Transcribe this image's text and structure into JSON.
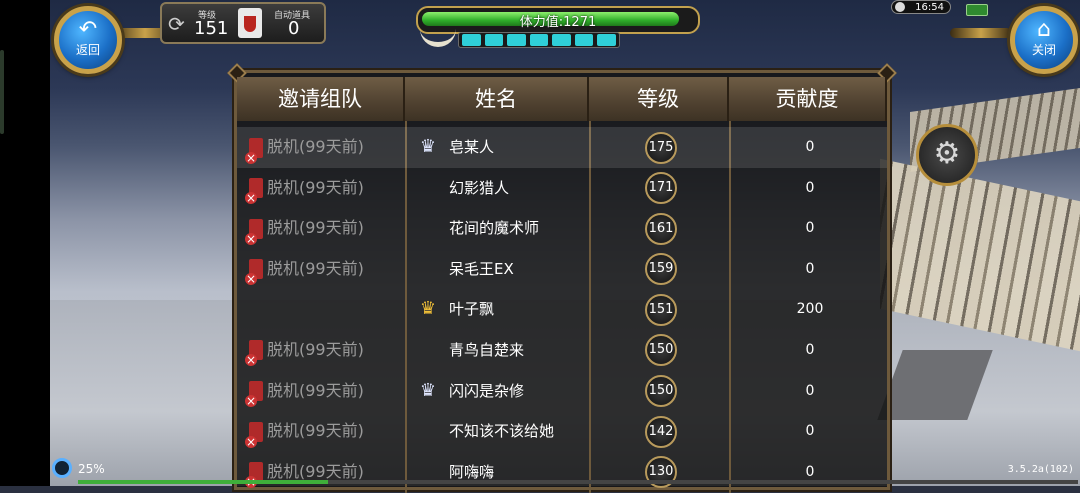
{
  "hud": {
    "back_icon": "back-arrow-icon",
    "back_label": "返回",
    "close_label": "关闭",
    "close_icon": "home-icon",
    "level_label": "等级",
    "level_value": "151",
    "auto_item_label": "自动道具",
    "auto_item_value": "0",
    "stamina_text": "体力值:1271",
    "stamina_fill": 0.96,
    "energy_segments": 7,
    "clock": "16:54",
    "load_percent": "25%",
    "load_progress": 0.25,
    "version": "3.5.2a(102)",
    "accent_color": "#c9a24a"
  },
  "table": {
    "headers": [
      "邀请组队",
      "姓名",
      "等级",
      "贡献度"
    ],
    "rows": [
      {
        "invite": "脱机(99天前)",
        "badge": "silver",
        "name": "皂某人",
        "level": "175",
        "contribution": "0",
        "selected": true
      },
      {
        "invite": "脱机(99天前)",
        "badge": "",
        "name": "幻影猎人",
        "level": "171",
        "contribution": "0",
        "selected": false
      },
      {
        "invite": "脱机(99天前)",
        "badge": "",
        "name": "花间的魔术师",
        "level": "161",
        "contribution": "0",
        "selected": false
      },
      {
        "invite": "脱机(99天前)",
        "badge": "",
        "name": "呆毛王EX",
        "level": "159",
        "contribution": "0",
        "selected": false
      },
      {
        "invite": "",
        "badge": "gold",
        "name": "叶子飘",
        "level": "151",
        "contribution": "200",
        "selected": false
      },
      {
        "invite": "脱机(99天前)",
        "badge": "",
        "name": "青鸟自楚来",
        "level": "150",
        "contribution": "0",
        "selected": false
      },
      {
        "invite": "脱机(99天前)",
        "badge": "silver",
        "name": "闪闪是杂修",
        "level": "150",
        "contribution": "0",
        "selected": false
      },
      {
        "invite": "脱机(99天前)",
        "badge": "",
        "name": "不知该不该给她",
        "level": "142",
        "contribution": "0",
        "selected": false
      },
      {
        "invite": "脱机(99天前)",
        "badge": "",
        "name": "阿嗨嗨",
        "level": "130",
        "contribution": "0",
        "selected": false
      }
    ]
  }
}
